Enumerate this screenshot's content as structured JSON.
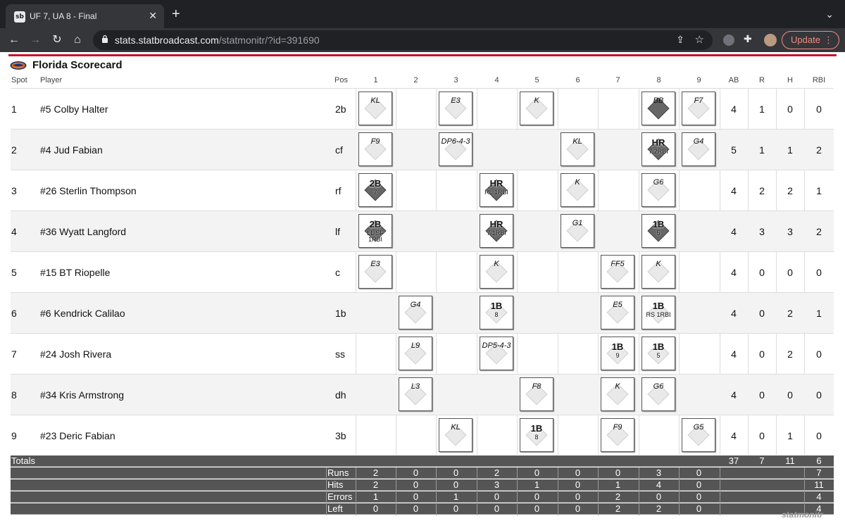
{
  "browser": {
    "tab_title": "UF 7, UA 8 - Final",
    "favicon_text": "sb",
    "url_host": "stats.statbroadcast.com",
    "url_path": "/statmonitr/?id=391690",
    "update_label": "Update"
  },
  "page": {
    "title": "Florida Scorecard",
    "watermark": "statmonitr"
  },
  "headers": {
    "spot": "Spot",
    "player": "Player",
    "pos": "Pos",
    "innings": [
      "1",
      "2",
      "3",
      "4",
      "5",
      "6",
      "7",
      "8",
      "9"
    ],
    "ab": "AB",
    "r": "R",
    "h": "H",
    "rbi": "RBI"
  },
  "players": [
    {
      "spot": "1",
      "name": "#5 Colby Halter",
      "pos": "2b",
      "ab": "4",
      "r": "1",
      "h": "0",
      "rbi": "0",
      "pa": [
        {
          "inn": 1,
          "res": "KL"
        },
        {
          "inn": 3,
          "res": "E3"
        },
        {
          "inn": 5,
          "res": "K"
        },
        {
          "inn": 8,
          "res": "BB",
          "dark": true
        },
        {
          "inn": 9,
          "res": "F7"
        }
      ]
    },
    {
      "spot": "2",
      "name": "#4 Jud Fabian",
      "pos": "cf",
      "ab": "5",
      "r": "1",
      "h": "1",
      "rbi": "2",
      "pa": [
        {
          "inn": 1,
          "res": "F9"
        },
        {
          "inn": 3,
          "res": "DP6-4-3"
        },
        {
          "inn": 6,
          "res": "KL"
        },
        {
          "inn": 8,
          "res": "HR",
          "sub": "7 2RBI",
          "hit": true,
          "dark": true
        },
        {
          "inn": 9,
          "res": "G4"
        }
      ]
    },
    {
      "spot": "3",
      "name": "#26 Sterlin Thompson",
      "pos": "rf",
      "ab": "4",
      "r": "2",
      "h": "2",
      "rbi": "1",
      "pa": [
        {
          "inn": 1,
          "res": "2B",
          "sub": "7",
          "hit": true,
          "dark": true
        },
        {
          "inn": 4,
          "res": "HR",
          "sub": "RL 1RBI",
          "hit": true,
          "dark": true
        },
        {
          "inn": 6,
          "res": "K"
        },
        {
          "inn": 8,
          "res": "G6"
        }
      ]
    },
    {
      "spot": "4",
      "name": "#36 Wyatt Langford",
      "pos": "lf",
      "ab": "4",
      "r": "3",
      "h": "3",
      "rbi": "2",
      "pa": [
        {
          "inn": 1,
          "res": "2B",
          "sub": "LL SF 1RBI",
          "hit": true,
          "dark": true
        },
        {
          "inn": 4,
          "res": "HR",
          "sub": "7 1RBI",
          "hit": true,
          "dark": true
        },
        {
          "inn": 6,
          "res": "G1"
        },
        {
          "inn": 8,
          "res": "1B",
          "sub": "5",
          "hit": true,
          "dark": true
        }
      ]
    },
    {
      "spot": "5",
      "name": "#15 BT Riopelle",
      "pos": "c",
      "ab": "4",
      "r": "0",
      "h": "0",
      "rbi": "0",
      "pa": [
        {
          "inn": 1,
          "res": "E3"
        },
        {
          "inn": 4,
          "res": "K"
        },
        {
          "inn": 7,
          "res": "FF5"
        },
        {
          "inn": 8,
          "res": "K"
        }
      ]
    },
    {
      "spot": "6",
      "name": "#6 Kendrick Calilao",
      "pos": "1b",
      "ab": "4",
      "r": "0",
      "h": "2",
      "rbi": "1",
      "pa": [
        {
          "inn": 2,
          "res": "G4"
        },
        {
          "inn": 4,
          "res": "1B",
          "sub": "8",
          "hit": true
        },
        {
          "inn": 7,
          "res": "E5"
        },
        {
          "inn": 8,
          "res": "1B",
          "sub": "RS 1RBI",
          "hit": true
        }
      ]
    },
    {
      "spot": "7",
      "name": "#24 Josh Rivera",
      "pos": "ss",
      "ab": "4",
      "r": "0",
      "h": "2",
      "rbi": "0",
      "pa": [
        {
          "inn": 2,
          "res": "L9"
        },
        {
          "inn": 4,
          "res": "DP5-4-3"
        },
        {
          "inn": 7,
          "res": "1B",
          "sub": "9",
          "hit": true
        },
        {
          "inn": 8,
          "res": "1B",
          "sub": "5",
          "hit": true
        }
      ]
    },
    {
      "spot": "8",
      "name": "#34 Kris Armstrong",
      "pos": "dh",
      "ab": "4",
      "r": "0",
      "h": "0",
      "rbi": "0",
      "pa": [
        {
          "inn": 2,
          "res": "L3"
        },
        {
          "inn": 5,
          "res": "F8"
        },
        {
          "inn": 7,
          "res": "K"
        },
        {
          "inn": 8,
          "res": "G6"
        }
      ]
    },
    {
      "spot": "9",
      "name": "#23 Deric Fabian",
      "pos": "3b",
      "ab": "4",
      "r": "0",
      "h": "1",
      "rbi": "0",
      "pa": [
        {
          "inn": 3,
          "res": "KL"
        },
        {
          "inn": 5,
          "res": "1B",
          "sub": "8",
          "hit": true
        },
        {
          "inn": 7,
          "res": "F9"
        },
        {
          "inn": 9,
          "res": "G5"
        }
      ]
    }
  ],
  "totals": {
    "label": "Totals",
    "ab": "37",
    "r": "7",
    "h": "11",
    "rbi": "6",
    "lines": [
      {
        "label": "Runs",
        "vals": [
          "2",
          "0",
          "0",
          "2",
          "0",
          "0",
          "0",
          "3",
          "0"
        ],
        "total": "7"
      },
      {
        "label": "Hits",
        "vals": [
          "2",
          "0",
          "0",
          "3",
          "1",
          "0",
          "1",
          "4",
          "0"
        ],
        "total": "11"
      },
      {
        "label": "Errors",
        "vals": [
          "1",
          "0",
          "1",
          "0",
          "0",
          "0",
          "2",
          "0",
          "0"
        ],
        "total": "4"
      },
      {
        "label": "Left",
        "vals": [
          "0",
          "0",
          "0",
          "0",
          "0",
          "0",
          "2",
          "2",
          "0"
        ],
        "total": "4"
      }
    ]
  }
}
